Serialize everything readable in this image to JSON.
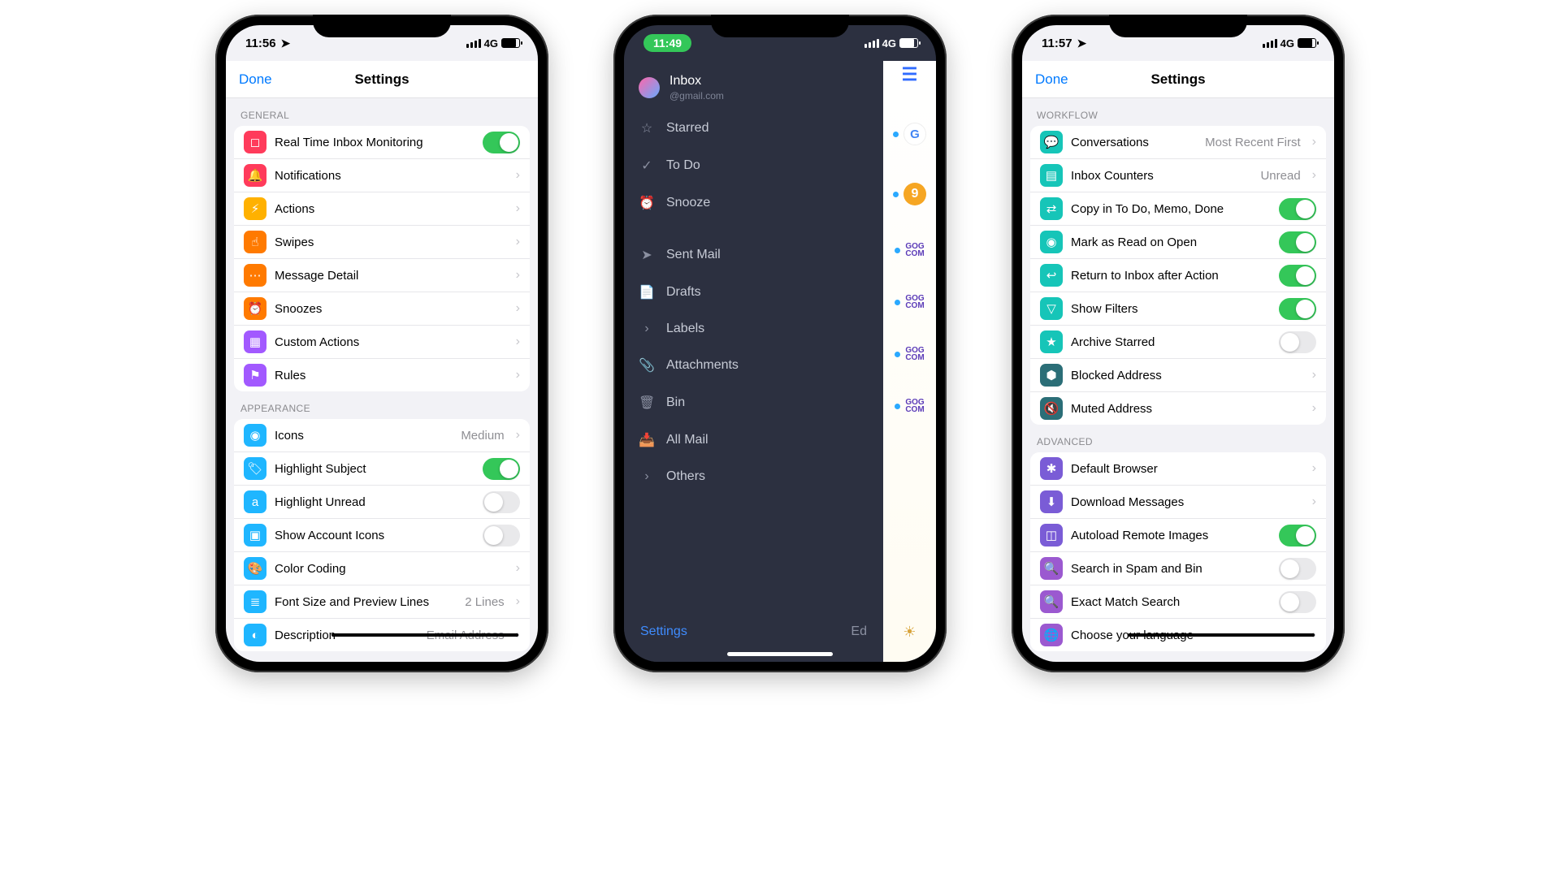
{
  "phone1": {
    "status": {
      "time": "11:56",
      "net": "4G"
    },
    "nav": {
      "done": "Done",
      "title": "Settings"
    },
    "section_general": "GENERAL",
    "general": [
      {
        "label": "Real Time Inbox Monitoring",
        "type": "toggle",
        "on": true
      },
      {
        "label": "Notifications",
        "type": "link"
      },
      {
        "label": "Actions",
        "type": "link"
      },
      {
        "label": "Swipes",
        "type": "link"
      },
      {
        "label": "Message Detail",
        "type": "link"
      },
      {
        "label": "Snoozes",
        "type": "link"
      },
      {
        "label": "Custom Actions",
        "type": "link"
      },
      {
        "label": "Rules",
        "type": "link"
      }
    ],
    "section_appearance": "APPEARANCE",
    "appearance": [
      {
        "label": "Icons",
        "type": "link",
        "value": "Medium"
      },
      {
        "label": "Highlight Subject",
        "type": "toggle",
        "on": true
      },
      {
        "label": "Highlight Unread",
        "type": "toggle",
        "on": false
      },
      {
        "label": "Show Account Icons",
        "type": "toggle",
        "on": false
      },
      {
        "label": "Color Coding",
        "type": "link"
      },
      {
        "label": "Font Size and Preview Lines",
        "type": "link",
        "value": "2 Lines"
      },
      {
        "label": "Description",
        "type": "link",
        "value": "Email Address"
      }
    ]
  },
  "phone2": {
    "status": {
      "time": "11:49",
      "net": "4G"
    },
    "account": {
      "name": "Inbox",
      "sub": "@gmail.com"
    },
    "items1": [
      "Starred",
      "To Do",
      "Snooze"
    ],
    "items2": [
      "Sent Mail",
      "Drafts",
      "Labels",
      "Attachments",
      "Bin",
      "All Mail",
      "Others"
    ],
    "bottom": {
      "settings": "Settings",
      "edit": "Ed"
    },
    "peek_number": "9",
    "peek_gog": "GOG\nCOM"
  },
  "phone3": {
    "status": {
      "time": "11:57",
      "net": "4G"
    },
    "nav": {
      "done": "Done",
      "title": "Settings"
    },
    "section_workflow": "WORKFLOW",
    "workflow": [
      {
        "label": "Conversations",
        "type": "link",
        "value": "Most Recent First"
      },
      {
        "label": "Inbox Counters",
        "type": "link",
        "value": "Unread"
      },
      {
        "label": "Copy in To Do, Memo, Done",
        "type": "toggle",
        "on": true
      },
      {
        "label": "Mark as Read on Open",
        "type": "toggle",
        "on": true
      },
      {
        "label": "Return to Inbox after Action",
        "type": "toggle",
        "on": true
      },
      {
        "label": "Show Filters",
        "type": "toggle",
        "on": true
      },
      {
        "label": "Archive Starred",
        "type": "toggle",
        "on": false
      },
      {
        "label": "Blocked Address",
        "type": "link"
      },
      {
        "label": "Muted Address",
        "type": "link"
      }
    ],
    "section_advanced": "ADVANCED",
    "advanced": [
      {
        "label": "Default Browser",
        "type": "link"
      },
      {
        "label": "Download Messages",
        "type": "link"
      },
      {
        "label": "Autoload Remote Images",
        "type": "toggle",
        "on": true
      },
      {
        "label": "Search in Spam and Bin",
        "type": "toggle",
        "on": false
      },
      {
        "label": "Exact Match Search",
        "type": "toggle",
        "on": false
      },
      {
        "label": "Choose your language",
        "type": "link"
      }
    ]
  }
}
